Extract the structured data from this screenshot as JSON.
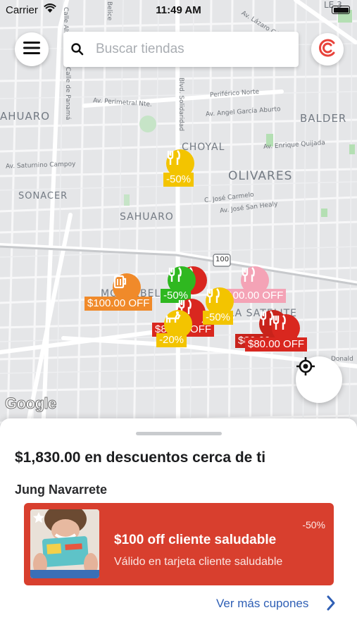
{
  "status_bar": {
    "carrier": "Carrier",
    "time": "11:49 AM"
  },
  "search": {
    "placeholder": "Buscar tiendas"
  },
  "map": {
    "neighborhoods": [
      "AHUARO",
      "BALDER",
      "CHOYAL",
      "OLIVARES",
      "SONACER",
      "SAHUARO",
      "MONTEBEL",
      "VILLA SATELITE"
    ],
    "streets": [
      "Belice",
      "Calle Alta",
      "Calle de Panamá",
      "Av. Perimetral Nte.",
      "Blvd. Solidaridad",
      "Av. Lázaro Cárdenas",
      "Periférico Norte",
      "Av. Angel García Aburto",
      "Av. Enrique Quijada",
      "Av. Saturnino Campoy",
      "C. José Carmelo",
      "Av. José San Healy",
      "Donald",
      "LE 3",
      "100"
    ],
    "attribution": "Google"
  },
  "pins": [
    {
      "icon": "fork-knife-icon",
      "color": "#f3c400",
      "label": "-50%"
    },
    {
      "icon": "beer-mug-icon",
      "color": "#f08a2a",
      "label": "$100.00 OFF"
    },
    {
      "icon": "fork-knife-icon",
      "color": "#d9271f",
      "label": ""
    },
    {
      "icon": "fork-knife-icon",
      "color": "#2fb820",
      "label": "-50%"
    },
    {
      "icon": "fork-knife-icon",
      "color": "#f4a3b6",
      "label": "$100.00 OFF"
    },
    {
      "icon": "fork-knife-icon",
      "color": "#d9271f",
      "label": "$80.00 OFF"
    },
    {
      "icon": "fork-knife-icon",
      "color": "#f3c400",
      "label": "-50%"
    },
    {
      "icon": "dog-icon",
      "color": "#f3c400",
      "label": "-20%"
    },
    {
      "icon": "fork-knife-icon",
      "color": "#c8231b",
      "label": "$80.00 OFF"
    },
    {
      "icon": "fork-knife-icon",
      "color": "#d9271f",
      "label": "$80.00 OFF"
    }
  ],
  "sheet": {
    "title": "$1,830.00 en descuentos cerca de ti",
    "store_name": "Jung Navarrete",
    "coupon": {
      "title": "$100 off cliente saludable",
      "subtitle": "Válido en tarjeta cliente saludable",
      "discount": "-50%",
      "color": "#d83f2e"
    },
    "more_link": "Ver más cupones"
  }
}
